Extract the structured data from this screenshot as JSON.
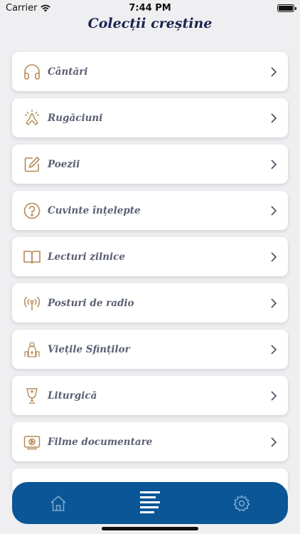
{
  "status_bar": {
    "carrier": "Carrier",
    "time": "7:44 PM"
  },
  "page": {
    "title": "Colecții creștine"
  },
  "items": [
    {
      "label": "Cântări",
      "icon": "headphones-icon"
    },
    {
      "label": "Rugăciuni",
      "icon": "praying-hands-icon"
    },
    {
      "label": "Poezii",
      "icon": "edit-note-icon"
    },
    {
      "label": "Cuvinte înțelepte",
      "icon": "question-circle-icon"
    },
    {
      "label": "Lecturi zilnice",
      "icon": "open-book-icon"
    },
    {
      "label": "Posturi de radio",
      "icon": "radio-antenna-icon"
    },
    {
      "label": "Viețile Sfinților",
      "icon": "saints-icon"
    },
    {
      "label": "Liturgică",
      "icon": "chalice-icon"
    },
    {
      "label": "Filme documentare",
      "icon": "video-icon"
    }
  ],
  "tab_bar": {
    "tabs": [
      {
        "icon": "home-icon",
        "active": false
      },
      {
        "icon": "list-icon",
        "active": true
      },
      {
        "icon": "gear-icon",
        "active": false
      }
    ]
  },
  "colors": {
    "accent": "#b48a55",
    "tab_bar": "#0a5696",
    "title": "#1b2350"
  }
}
